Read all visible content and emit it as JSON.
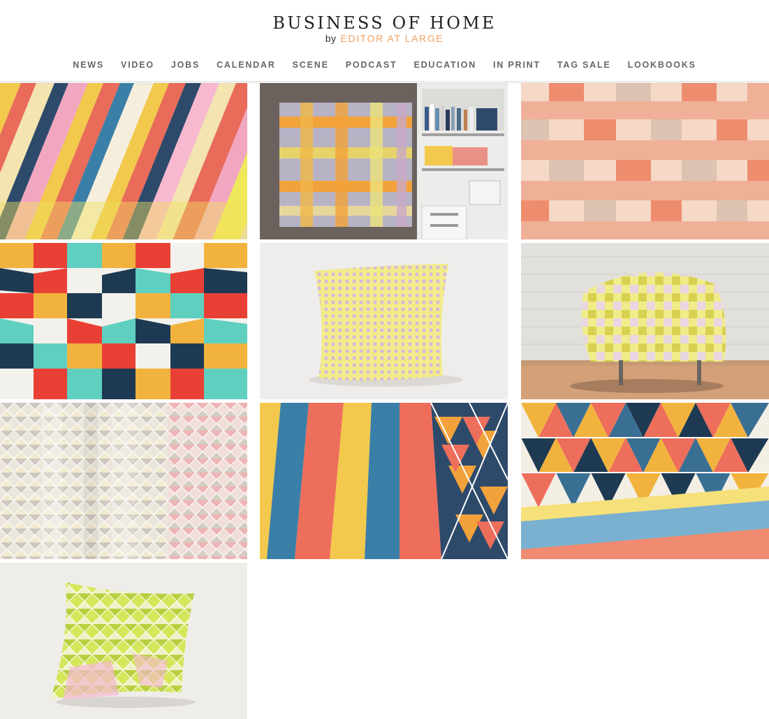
{
  "header": {
    "logo_main": "BUSINESS OF HOME",
    "logo_by": "by",
    "logo_sub": "EDITOR AT LARGE",
    "accent_color": "#f0a060"
  },
  "nav": {
    "items": [
      "NEWS",
      "VIDEO",
      "JOBS",
      "CALENDAR",
      "SCENE",
      "PODCAST",
      "EDUCATION",
      "IN PRINT",
      "TAG SALE",
      "LOOKBOOKS"
    ]
  },
  "gallery": {
    "images": [
      {
        "subject": "diagonal striped fabric"
      },
      {
        "subject": "plaid wall hanging beside shelves"
      },
      {
        "subject": "coral checked fabric"
      },
      {
        "subject": "bold geometric block print"
      },
      {
        "subject": "yellow patterned pillow"
      },
      {
        "subject": "checked armchair"
      },
      {
        "subject": "grey triangle print fabric"
      },
      {
        "subject": "striped and triangle fabric"
      },
      {
        "subject": "multicolor triangle print"
      },
      {
        "subject": "lime triangle pillow"
      }
    ]
  }
}
